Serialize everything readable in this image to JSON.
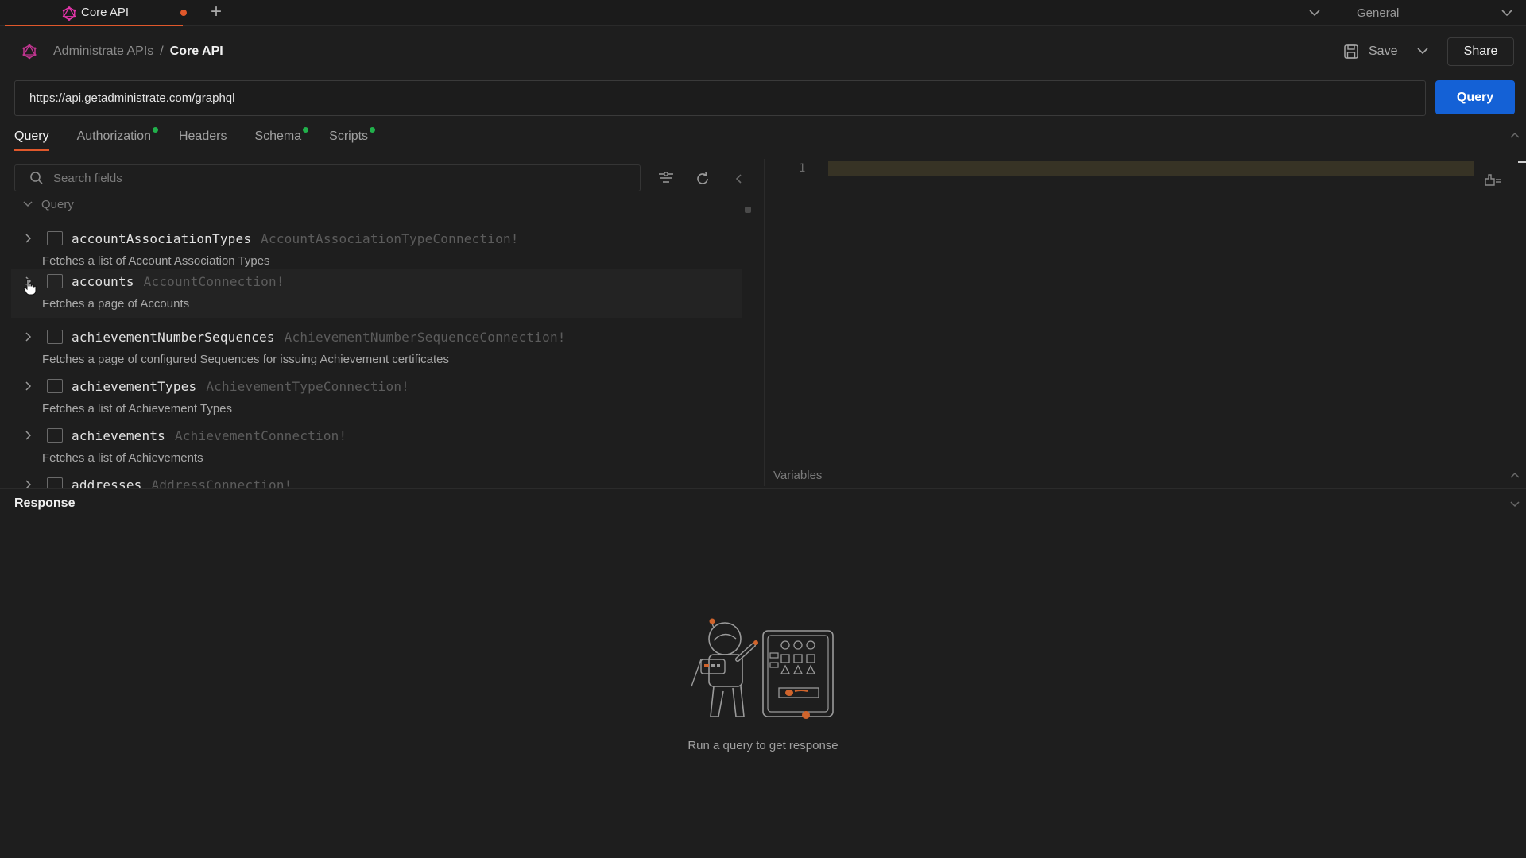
{
  "tabbar": {
    "tab_title": "Core API",
    "environment": "General"
  },
  "breadcrumb": {
    "parent": "Administrate APIs",
    "separator": "/",
    "current": "Core API"
  },
  "toolbar": {
    "save_label": "Save",
    "share_label": "Share"
  },
  "request": {
    "url": "https://api.getadministrate.com/graphql",
    "send_label": "Query",
    "tabs": [
      {
        "label": "Query",
        "active": true,
        "indicator": false
      },
      {
        "label": "Authorization",
        "active": false,
        "indicator": true
      },
      {
        "label": "Headers",
        "active": false,
        "indicator": false
      },
      {
        "label": "Schema",
        "active": false,
        "indicator": true
      },
      {
        "label": "Scripts",
        "active": false,
        "indicator": true
      }
    ]
  },
  "explorer": {
    "search_placeholder": "Search fields",
    "section": "Query",
    "fields": [
      {
        "name": "accountAssociationTypes",
        "type": "AccountAssociationTypeConnection!",
        "description": "Fetches a list of Account Association Types"
      },
      {
        "name": "accounts",
        "type": "AccountConnection!",
        "description": "Fetches a page of Accounts"
      },
      {
        "name": "achievementNumberSequences",
        "type": "AchievementNumberSequenceConnection!",
        "description": "Fetches a page of configured Sequences for issuing Achievement certificates"
      },
      {
        "name": "achievementTypes",
        "type": "AchievementTypeConnection!",
        "description": "Fetches a list of Achievement Types"
      },
      {
        "name": "achievements",
        "type": "AchievementConnection!",
        "description": "Fetches a list of Achievements"
      },
      {
        "name": "addresses",
        "type": "AddressConnection!",
        "description": ""
      }
    ]
  },
  "editor": {
    "line_number": "1",
    "variables_label": "Variables"
  },
  "response": {
    "title": "Response",
    "empty_message": "Run a query to get response"
  },
  "colors": {
    "accent": "#e0582b",
    "primary_button": "#1461d6",
    "indicator": "#21b04b",
    "background": "#1e1e1e"
  }
}
